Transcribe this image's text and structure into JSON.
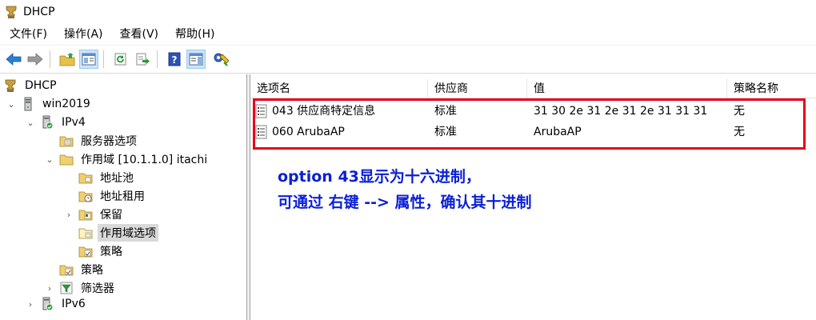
{
  "window": {
    "title": "DHCP"
  },
  "menu": [
    "文件(F)",
    "操作(A)",
    "查看(V)",
    "帮助(H)"
  ],
  "toolbar": [
    "back-icon",
    "forward-icon",
    "up-folder-icon",
    "show-hide-tree-icon",
    "refresh-icon",
    "export-list-icon",
    "help-icon",
    "properties-pane-icon",
    "dhcp-action-icon"
  ],
  "tree": {
    "root": "DHCP",
    "server": "win2019",
    "ipv4": "IPv4",
    "server_options": "服务器选项",
    "scope": "作用域 [10.1.1.0] itachi",
    "address_pool": "地址池",
    "address_leases": "地址租用",
    "reservations": "保留",
    "scope_options": "作用域选项",
    "scope_policies": "策略",
    "policies": "策略",
    "filters": "筛选器",
    "ipv6": "IPv6"
  },
  "list": {
    "columns": [
      "选项名",
      "供应商",
      "值",
      "策略名称"
    ],
    "rows": [
      {
        "name": "043 供应商特定信息",
        "vendor": "标准",
        "value": "31 30 2e 31 2e 31 2e 31 31 31",
        "policy": "无"
      },
      {
        "name": "060 ArubaAP",
        "vendor": "标准",
        "value": "ArubaAP",
        "policy": "无"
      }
    ]
  },
  "annotation": {
    "line1": "option 43显示为十六进制，",
    "line2": "可通过 右键 --> 属性，确认其十进制"
  },
  "colors": {
    "highlight_box": "#e8001c",
    "annotation_text": "#0a1fd6"
  }
}
